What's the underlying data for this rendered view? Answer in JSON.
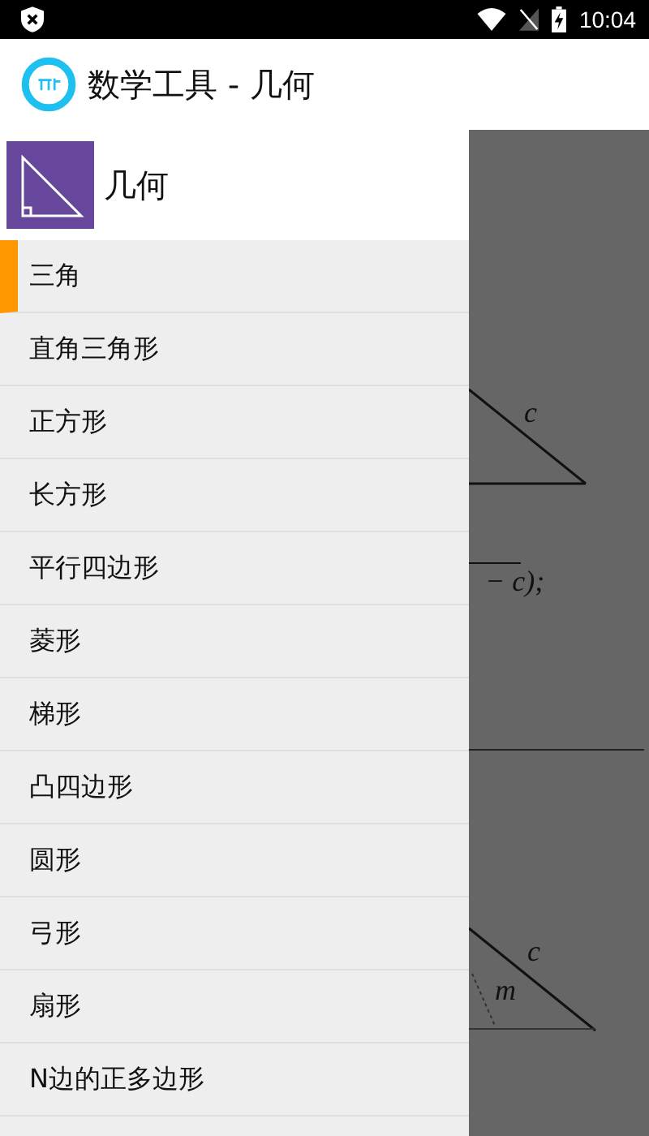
{
  "status_bar": {
    "time": "10:04"
  },
  "app_bar": {
    "title": "数学工具 - 几何"
  },
  "drawer": {
    "header": "几何",
    "items": [
      {
        "label": "三角",
        "selected": true
      },
      {
        "label": "直角三角形",
        "selected": false
      },
      {
        "label": "正方形",
        "selected": false
      },
      {
        "label": "长方形",
        "selected": false
      },
      {
        "label": "平行四边形",
        "selected": false
      },
      {
        "label": "菱形",
        "selected": false
      },
      {
        "label": "梯形",
        "selected": false
      },
      {
        "label": "凸四边形",
        "selected": false
      },
      {
        "label": "圆形",
        "selected": false
      },
      {
        "label": "弓形",
        "selected": false
      },
      {
        "label": "扇形",
        "selected": false
      },
      {
        "label": "N边的正多边形",
        "selected": false
      }
    ]
  },
  "background_content": {
    "labels": [
      "c",
      "− c);",
      "c",
      "m"
    ]
  }
}
